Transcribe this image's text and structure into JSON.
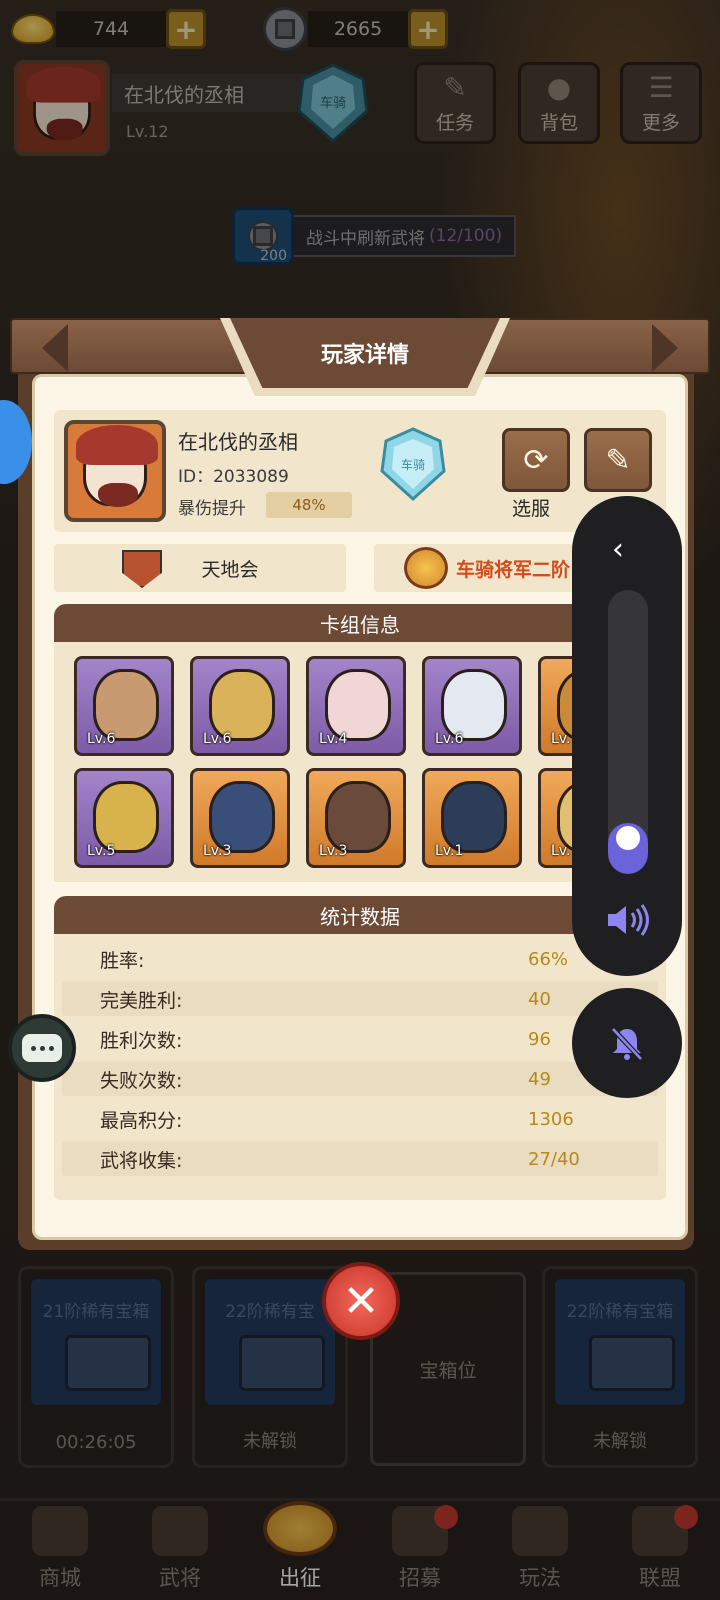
{
  "currency": {
    "gold": "744",
    "coins": "2665"
  },
  "header": {
    "player_name": "在北伐的丞相",
    "level": "Lv.12",
    "rank_text": "车骑",
    "buttons": {
      "task": "任务",
      "bag": "背包",
      "more": "更多"
    }
  },
  "refresh": {
    "cost": "200",
    "text": "战斗中刷新武将",
    "count": "(12/100)"
  },
  "dialog": {
    "title": "玩家详情",
    "profile": {
      "name": "在北伐的丞相",
      "id": "ID：2033089",
      "crit_label": "暴伤提升",
      "crit_value": "48%",
      "rank_text": "车骑",
      "server_label": "选服"
    },
    "guild": "天地会",
    "title_name": "车骑将军二阶",
    "deck_header": "卡组信息",
    "deck": [
      {
        "level": "Lv.6",
        "rarity": "purple",
        "color": "#c89a72"
      },
      {
        "level": "Lv.6",
        "rarity": "purple",
        "color": "#d9b25a"
      },
      {
        "level": "Lv.4",
        "rarity": "purple",
        "color": "#f1d6d6"
      },
      {
        "level": "Lv.6",
        "rarity": "purple",
        "color": "#e4e8f0"
      },
      {
        "level": "Lv.",
        "rarity": "orange",
        "color": "#c98a3a"
      },
      {
        "level": "Lv.5",
        "rarity": "purple",
        "color": "#d8b24a"
      },
      {
        "level": "Lv.3",
        "rarity": "orange",
        "color": "#3a4e7a"
      },
      {
        "level": "Lv.3",
        "rarity": "orange",
        "color": "#6a4a3a"
      },
      {
        "level": "Lv.1",
        "rarity": "orange",
        "color": "#2c3d5a"
      },
      {
        "level": "Lv.",
        "rarity": "orange",
        "color": "#e0c070"
      }
    ],
    "stats_header": "统计数据",
    "stats": [
      {
        "label": "胜率:",
        "value": "66%"
      },
      {
        "label": "完美胜利:",
        "value": "40"
      },
      {
        "label": "胜利次数:",
        "value": "96"
      },
      {
        "label": "失败次数:",
        "value": "49"
      },
      {
        "label": "最高积分:",
        "value": "1306"
      },
      {
        "label": "武将收集:",
        "value": "27/40"
      }
    ]
  },
  "chests": [
    {
      "title": "21阶稀有宝箱",
      "footer": "00:26:05"
    },
    {
      "title": "22阶稀有宝",
      "footer": "未解锁"
    },
    {
      "title": "",
      "footer": "宝箱位"
    },
    {
      "title": "22阶稀有宝箱",
      "footer": "未解锁"
    }
  ],
  "nav": [
    {
      "label": "商城",
      "active": false,
      "dot": false
    },
    {
      "label": "武将",
      "active": false,
      "dot": false
    },
    {
      "label": "出征",
      "active": true,
      "dot": false
    },
    {
      "label": "招募",
      "active": false,
      "dot": true
    },
    {
      "label": "玩法",
      "active": false,
      "dot": false
    },
    {
      "label": "联盟",
      "active": false,
      "dot": true
    }
  ],
  "volume": {
    "level": 0.18,
    "accent": "#6a63d9"
  }
}
